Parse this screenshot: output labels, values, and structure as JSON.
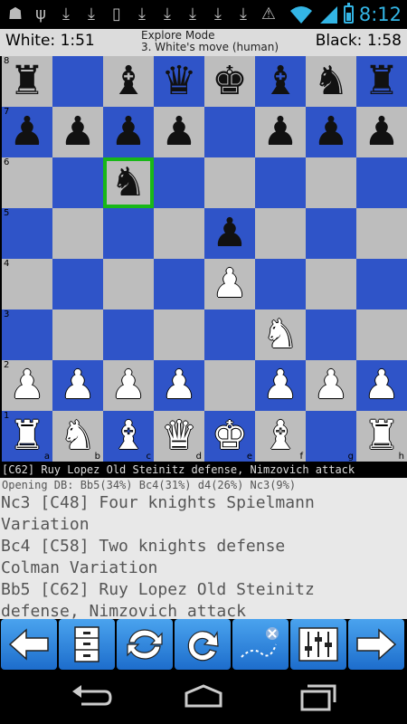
{
  "status_bar": {
    "time": "8:12",
    "icons": [
      "android-icon",
      "usb-icon",
      "download-icon",
      "download-icon",
      "phone-icon",
      "download-icon",
      "download-icon",
      "download-icon",
      "download-icon",
      "download-icon",
      "warning-icon"
    ]
  },
  "header": {
    "white_clock": "White: 1:51",
    "black_clock": "Black: 1:58",
    "mode": "Explore Mode",
    "turn": "3. White's move (human)"
  },
  "board": {
    "ranks": [
      "8",
      "7",
      "6",
      "5",
      "4",
      "3",
      "2",
      "1"
    ],
    "files": [
      "a",
      "b",
      "c",
      "d",
      "e",
      "f",
      "g",
      "h"
    ],
    "rows": [
      [
        "r",
        "",
        "b",
        "q",
        "k",
        "b",
        "n",
        "r"
      ],
      [
        "p",
        "p",
        "p",
        "p",
        "",
        "p",
        "p",
        "p"
      ],
      [
        "",
        "",
        "n",
        "",
        "",
        "",
        "",
        ""
      ],
      [
        "",
        "",
        "",
        "",
        "p",
        "",
        "",
        ""
      ],
      [
        "",
        "",
        "",
        "",
        "P",
        "",
        "",
        ""
      ],
      [
        "",
        "",
        "",
        "",
        "",
        "N",
        "",
        ""
      ],
      [
        "P",
        "P",
        "P",
        "P",
        "",
        "P",
        "P",
        "P"
      ],
      [
        "R",
        "N",
        "B",
        "Q",
        "K",
        "B",
        "",
        "R"
      ]
    ],
    "selected_square": "c6",
    "colors": {
      "light": "#bdbdbd",
      "dark": "#2f54c8",
      "highlight": "#18b818"
    }
  },
  "opening": {
    "current": "[C62] Ruy Lopez Old Steinitz defense, Nimzovich attack",
    "db": "Opening DB: Bb5(34%) Bc4(31%) d4(26%) Nc3(9%)"
  },
  "moves": [
    "Nc3  [C48] Four knights Spielmann",
    "Variation",
    "Bc4  [C58] Two knights defense",
    "Colman Variation",
    "Bb5  [C62] Ruy Lopez Old Steinitz",
    "defense, Nimzovich attack"
  ],
  "toolbar": [
    "back-arrow-icon",
    "file-cabinet-icon",
    "flip-board-icon",
    "redo-icon",
    "explore-path-icon",
    "settings-sliders-icon",
    "forward-arrow-icon"
  ],
  "navbar": [
    "back-icon",
    "home-icon",
    "recent-apps-icon"
  ]
}
